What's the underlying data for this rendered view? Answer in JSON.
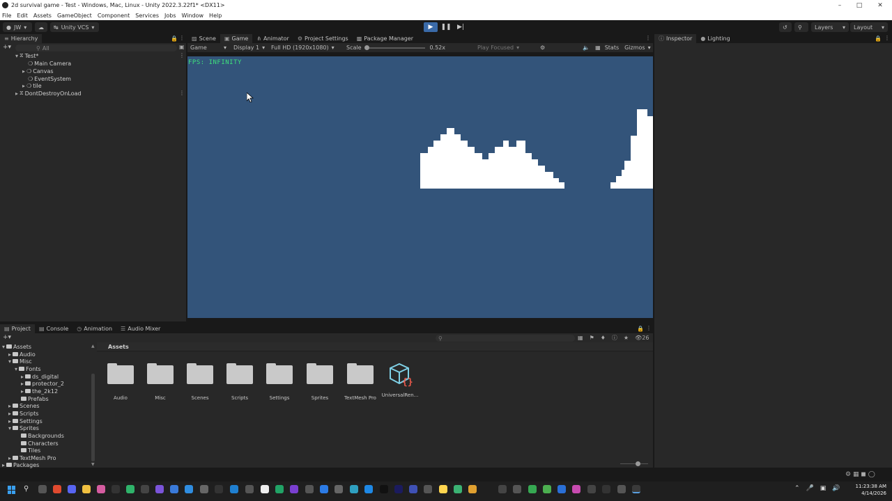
{
  "window": {
    "title": "2d survival game - Test - Windows, Mac, Linux - Unity 2022.3.22f1* <DX11>"
  },
  "menu": [
    "File",
    "Edit",
    "Assets",
    "GameObject",
    "Component",
    "Services",
    "Jobs",
    "Window",
    "Help"
  ],
  "toolbar": {
    "account": "JW",
    "vcs": "Unity VCS",
    "layers": "Layers",
    "layout": "Layout"
  },
  "hierarchy": {
    "tab": "Hierarchy",
    "search_placeholder": "All",
    "items": [
      {
        "label": "Test*",
        "indent": 0
      },
      {
        "label": "Main Camera",
        "indent": 1
      },
      {
        "label": "Canvas",
        "indent": 1
      },
      {
        "label": "EventSystem",
        "indent": 1
      },
      {
        "label": "tile",
        "indent": 1
      },
      {
        "label": "DontDestroyOnLoad",
        "indent": 0
      }
    ]
  },
  "center_tabs": [
    "Scene",
    "Game",
    "Animator",
    "Project Settings",
    "Package Manager"
  ],
  "game_toolbar": {
    "mode": "Game",
    "display": "Display 1",
    "resolution": "Full HD (1920x1080)",
    "scale_label": "Scale",
    "scale_value": "0.52x",
    "play_focused": "Play Focused",
    "stats": "Stats",
    "gizmos": "Gizmos"
  },
  "game_view": {
    "fps_text": "FPS: INFINITY",
    "bg_color": "#33547a"
  },
  "right_tabs": [
    "Inspector",
    "Lighting"
  ],
  "bottom_tabs": [
    "Project",
    "Console",
    "Animation",
    "Audio Mixer"
  ],
  "project": {
    "count": "26",
    "breadcrumb": "Assets",
    "tree": [
      {
        "label": "Assets"
      },
      {
        "label": "Audio"
      },
      {
        "label": "Misc"
      },
      {
        "label": "Fonts"
      },
      {
        "label": "ds_digital"
      },
      {
        "label": "protector_2"
      },
      {
        "label": "the_2k12"
      },
      {
        "label": "Prefabs"
      },
      {
        "label": "Scenes"
      },
      {
        "label": "Scripts"
      },
      {
        "label": "Settings"
      },
      {
        "label": "Sprites"
      },
      {
        "label": "Backgrounds"
      },
      {
        "label": "Characters"
      },
      {
        "label": "Tiles"
      },
      {
        "label": "TextMesh Pro"
      },
      {
        "label": "Packages"
      }
    ],
    "assets": [
      "Audio",
      "Misc",
      "Scenes",
      "Scripts",
      "Settings",
      "Sprites",
      "TextMesh Pro",
      "UniversalRen..."
    ]
  },
  "taskbar": {
    "time": "11:23:38 AM",
    "date": "4/14/2026"
  }
}
